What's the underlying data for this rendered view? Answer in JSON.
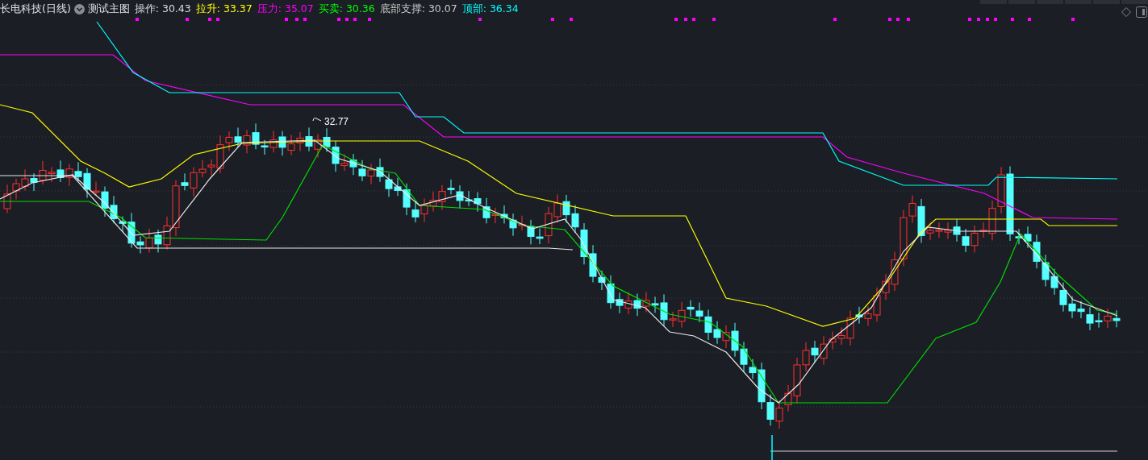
{
  "header": {
    "stock_name": "长电科技(日线)",
    "indicator": "测试主图",
    "readings": [
      {
        "label": "操作:",
        "value": "30.43",
        "color": "#dcdcdc"
      },
      {
        "label": "拉升:",
        "value": "33.37",
        "color": "#ffff00"
      },
      {
        "label": "压力:",
        "value": "35.07",
        "color": "#ff00ff"
      },
      {
        "label": "买卖:",
        "value": "30.36",
        "color": "#00ff00"
      },
      {
        "label": "底部支撑:",
        "value": "30.07",
        "color": "#c8c8c8"
      },
      {
        "label": "顶部:",
        "value": "36.34",
        "color": "#00ffff"
      }
    ]
  },
  "chart": {
    "high_label": "32.77"
  }
}
